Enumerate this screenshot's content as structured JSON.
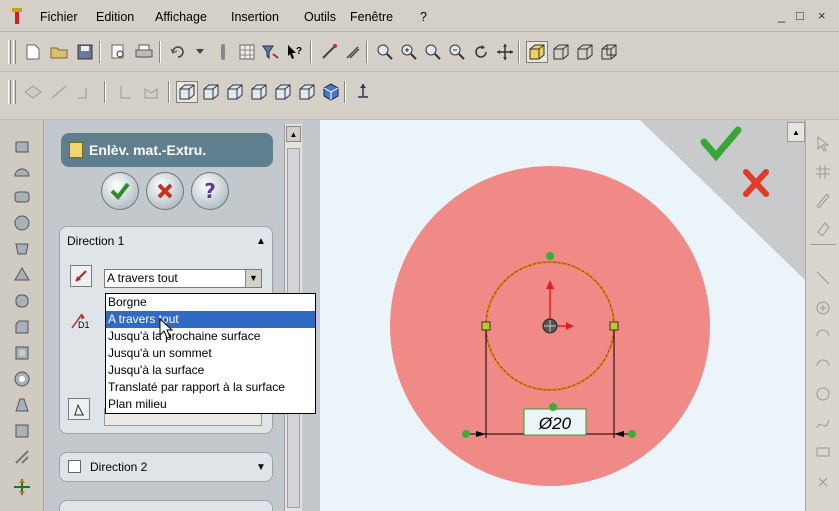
{
  "menu": {
    "items": [
      "Fichier",
      "Edition",
      "Affichage",
      "Insertion",
      "Outils",
      "Fenêtre",
      "?"
    ],
    "window_controls": [
      "_",
      "□",
      "×"
    ]
  },
  "property_manager": {
    "title": "Enlèv. mat.-Extru.",
    "ok_icon": "check-icon",
    "cancel_icon": "x-icon",
    "help_label": "?",
    "direction1": {
      "label": "Direction 1",
      "end_condition": "A travers tout",
      "options": [
        "Borgne",
        "A travers tout",
        "Jusqu'à la prochaine surface",
        "Jusqu'à un sommet",
        "Jusqu'à la surface",
        "Translaté par rapport à la surface",
        "Plan milieu"
      ],
      "selected_option": "A travers tout",
      "depth_label": "D1"
    },
    "direction2": {
      "label": "Direction 2"
    }
  },
  "graphics": {
    "dimension_label": "Ø20",
    "colors": {
      "face": "#f08a87",
      "sketch": "#e07a10",
      "ok_check": "#3aa63a",
      "cancel_x": "#e03a2a"
    }
  }
}
